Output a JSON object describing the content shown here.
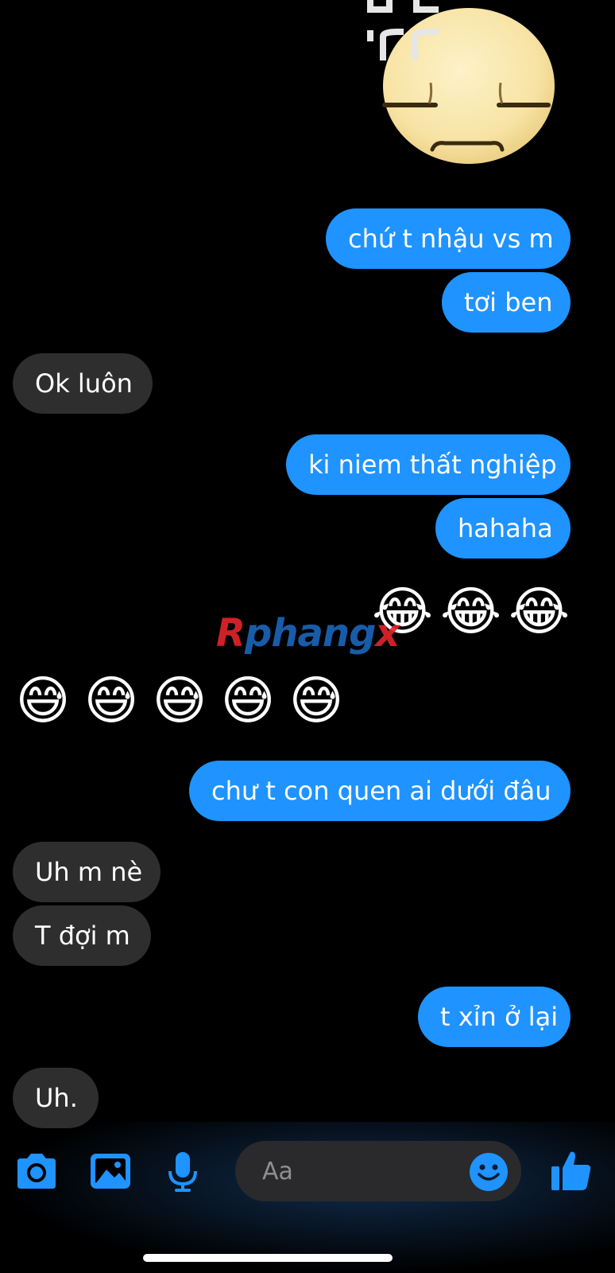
{
  "messages": [
    {
      "side": "out",
      "text": "chứ t nhậu vs m"
    },
    {
      "side": "out",
      "text": "tơi ben"
    },
    {
      "side": "in",
      "text": "Ok luôn"
    },
    {
      "side": "out",
      "text": "ki niem thất nghiệp"
    },
    {
      "side": "out",
      "text": "hahaha"
    },
    {
      "side": "out",
      "emoji": "😂😂😂"
    },
    {
      "side": "in",
      "emoji": "😅😅😅😅😅"
    },
    {
      "side": "out",
      "text": "chư t con quen ai dưới đâu"
    },
    {
      "side": "in",
      "text": "Uh m nè"
    },
    {
      "side": "in",
      "text": "T đợi m"
    },
    {
      "side": "out",
      "text": "t xỉn ở lại"
    },
    {
      "side": "in",
      "text": "Uh."
    }
  ],
  "watermark": {
    "part1": "R",
    "part2": "phang",
    "part3": "x"
  },
  "composer": {
    "placeholder": "Aa",
    "icons": [
      "camera-icon",
      "image-icon",
      "microphone-icon",
      "emoji-icon",
      "thumbs-up-icon"
    ]
  },
  "colors": {
    "outgoing": "#1f93ff",
    "incoming": "#2e2e2e",
    "background": "#000000",
    "accent": "#1f93ff"
  }
}
